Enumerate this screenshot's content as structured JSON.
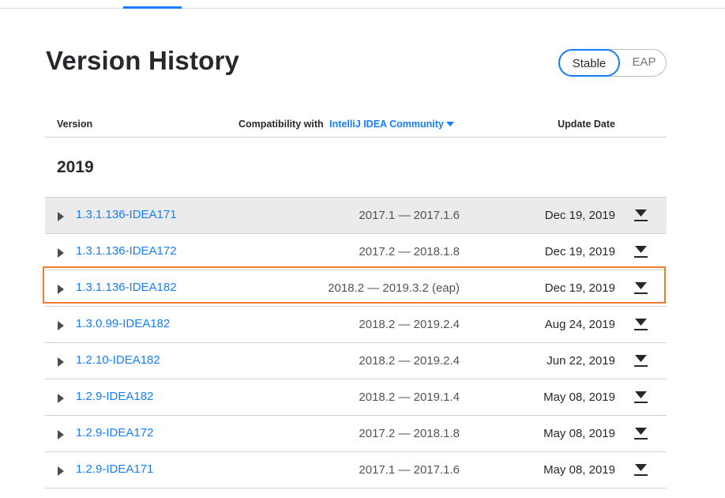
{
  "page": {
    "title": "Version History",
    "channel_toggle": {
      "stable_label": "Stable",
      "eap_label": "EAP",
      "selected": "Stable"
    }
  },
  "table": {
    "headers": {
      "version": "Version",
      "compatibility_prefix": "Compatibility with",
      "compatibility_product": "IntelliJ IDEA Community",
      "update_date": "Update Date"
    },
    "year": "2019",
    "rows": [
      {
        "version": "1.3.1.136-IDEA171",
        "compat": "2017.1 — 2017.1.6",
        "date": "Dec 19, 2019"
      },
      {
        "version": "1.3.1.136-IDEA172",
        "compat": "2017.2 — 2018.1.8",
        "date": "Dec 19, 2019"
      },
      {
        "version": "1.3.1.136-IDEA182",
        "compat": "2018.2 — 2019.3.2 (eap)",
        "date": "Dec 19, 2019"
      },
      {
        "version": "1.3.0.99-IDEA182",
        "compat": "2018.2 — 2019.2.4",
        "date": "Aug 24, 2019"
      },
      {
        "version": "1.2.10-IDEA182",
        "compat": "2018.2 — 2019.2.4",
        "date": "Jun 22, 2019"
      },
      {
        "version": "1.2.9-IDEA182",
        "compat": "2018.2 — 2019.1.4",
        "date": "May 08, 2019"
      },
      {
        "version": "1.2.9-IDEA172",
        "compat": "2017.2 — 2018.1.8",
        "date": "May 08, 2019"
      },
      {
        "version": "1.2.9-IDEA171",
        "compat": "2017.1 — 2017.1.6",
        "date": "May 08, 2019"
      }
    ]
  },
  "icons": {
    "expand": "triangle-right-icon",
    "download": "download-icon"
  },
  "colors": {
    "link": "#167dff",
    "highlight": "#ed7d31",
    "hover_row": "#ebebeb"
  }
}
